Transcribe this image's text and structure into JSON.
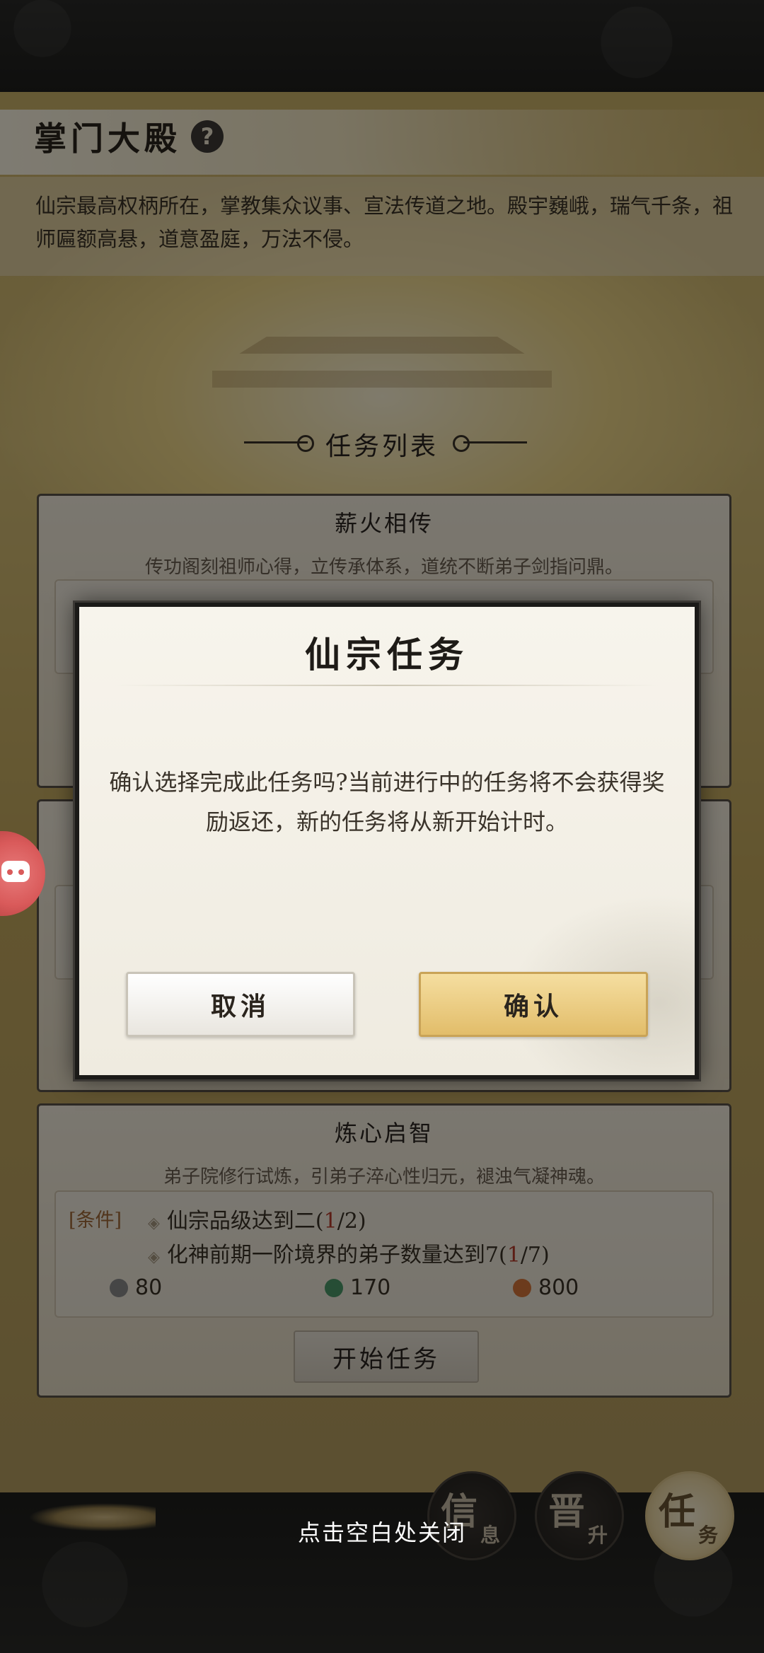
{
  "page": {
    "title": "掌门大殿",
    "help_icon": "?",
    "intro": "仙宗最高权柄所在，掌教集众议事、宣法传道之地。殿宇巍峨，瑞气千条，祖师匾额高悬，道意盈庭，万法不侵。",
    "section_title": "任务列表"
  },
  "tasks": [
    {
      "title": "薪火相传",
      "desc": "传功阁刻祖师心得，立传承体系，道统不断弟子剑指问鼎。"
    },
    {
      "title": "炼心启智",
      "desc": "弟子院修行试炼，引弟子淬心性归元，褪浊气凝神魂。",
      "cond_tag": "[条件]",
      "conditions": [
        {
          "text": "仙宗品级达到二(",
          "progress": "1",
          "total": "/2)"
        },
        {
          "text": "化神前期一阶境界的弟子数量达到7(",
          "progress": "1",
          "total": "/7)"
        }
      ],
      "rewards": [
        {
          "icon": "spirit-stone-icon",
          "value": "80",
          "color": "#8c8c8c"
        },
        {
          "icon": "herb-icon",
          "value": "170",
          "color": "#4c9a6a"
        },
        {
          "icon": "feather-icon",
          "value": "800",
          "color": "#d9773a"
        }
      ],
      "start_label": "开始任务"
    }
  ],
  "modal": {
    "title": "仙宗任务",
    "message": "确认选择完成此任务吗?当前进行中的任务将不会获得奖励返还，新的任务将从新开始计时。",
    "cancel_label": "取消",
    "confirm_label": "确认"
  },
  "nav": [
    {
      "main": "信",
      "sub": "息"
    },
    {
      "main": "晋",
      "sub": "升"
    },
    {
      "main": "任",
      "sub": "务"
    }
  ],
  "close_hint": "点击空白处关闭"
}
